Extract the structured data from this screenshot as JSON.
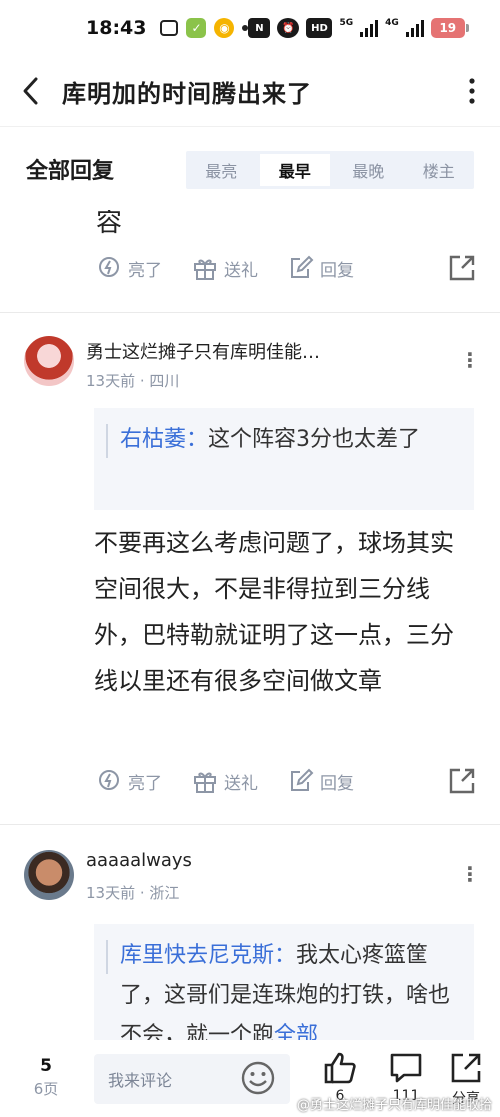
{
  "status_bar": {
    "time": "18:43",
    "network_1": "5G",
    "network_2": "4G",
    "hd_label": "HD",
    "battery": "19"
  },
  "title_bar": {
    "back_icon": "chevron-left-icon",
    "title": "库明加的时间腾出来了",
    "more_icon": "more-vertical-icon"
  },
  "reply_header": {
    "title": "全部回复",
    "sort_tabs": [
      {
        "label": "最亮",
        "active": false
      },
      {
        "label": "最早",
        "active": true
      },
      {
        "label": "最晚",
        "active": false
      },
      {
        "label": "楼主",
        "active": false
      }
    ]
  },
  "feed": {
    "partial_text": "容",
    "actions": {
      "like": "亮了",
      "gift": "送礼",
      "reply": "回复"
    },
    "posts": [
      {
        "username": "勇士这烂摊子只有库明佳能…",
        "time": "13天前",
        "location": "四川",
        "quote_author": "右枯萎：",
        "quote_text": "这个阵容3分也太差了",
        "body": "不要再这么考虑问题了，球场其实空间很大，不是非得拉到三分线外，巴特勒就证明了这一点，三分线以里还有很多空间做文章"
      },
      {
        "username": "aaaaalways",
        "time": "13天前",
        "location": "浙江",
        "quote_author": "库里快去尼克斯：",
        "quote_text": "我太心疼篮筐了，这哥们是连珠炮的打铁，啥也不会，就一个跑",
        "quote_more": "全部"
      }
    ]
  },
  "bottom_bar": {
    "page_current": "5",
    "page_total": "6页",
    "comment_placeholder": "我来评论",
    "like_count": "6",
    "comment_count": "111",
    "share_label": "分享"
  },
  "watermark": "@勇士这烂摊子只有库明佳能收拾",
  "colors": {
    "accent_blue": "#3a6fd8",
    "muted_gray": "#8d96a6",
    "tab_bg": "#eef2f9",
    "quote_bg": "#f4f6fa"
  }
}
